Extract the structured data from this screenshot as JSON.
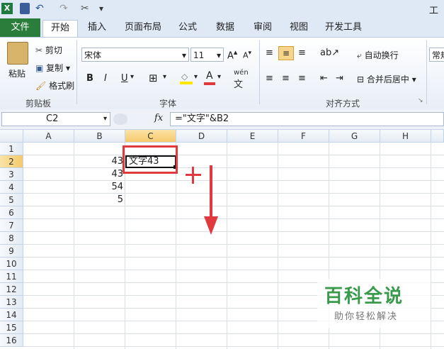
{
  "titlebar": {
    "title_fragment": "工作"
  },
  "tabs": [
    "文件",
    "开始",
    "插入",
    "页面布局",
    "公式",
    "数据",
    "审阅",
    "视图",
    "开发工具"
  ],
  "clipboard": {
    "paste": "粘贴",
    "cut": "剪切",
    "copy": "复制",
    "format_painter": "格式刷",
    "group": "剪贴板"
  },
  "font": {
    "name": "宋体",
    "size": "11",
    "bold": "B",
    "italic": "I",
    "underline": "U",
    "phonetic": "wén",
    "group": "字体"
  },
  "alignment": {
    "wrap": "自动换行",
    "merge": "合并后居中",
    "group": "对齐方式"
  },
  "number": {
    "format": "常规"
  },
  "formula_bar": {
    "name_box": "C2",
    "fx": "fx",
    "formula": "=\"文字\"&B2"
  },
  "columns": [
    "A",
    "B",
    "C",
    "D",
    "E",
    "F",
    "G",
    "H"
  ],
  "rows": [
    "1",
    "2",
    "3",
    "4",
    "5",
    "6",
    "7",
    "8",
    "9",
    "10",
    "11",
    "12",
    "13",
    "14",
    "15",
    "16"
  ],
  "cells": {
    "B2": "43",
    "B3": "43",
    "B4": "54",
    "B5": "5",
    "C2": "文字43"
  },
  "watermark": {
    "title": "百科全说",
    "subtitle": "助你轻松解决"
  },
  "colors": {
    "accent_red": "#e0393e",
    "file_tab": "#2a7d3a",
    "header_selected": "#f5c96b",
    "watermark_green": "#3a9a4c"
  }
}
